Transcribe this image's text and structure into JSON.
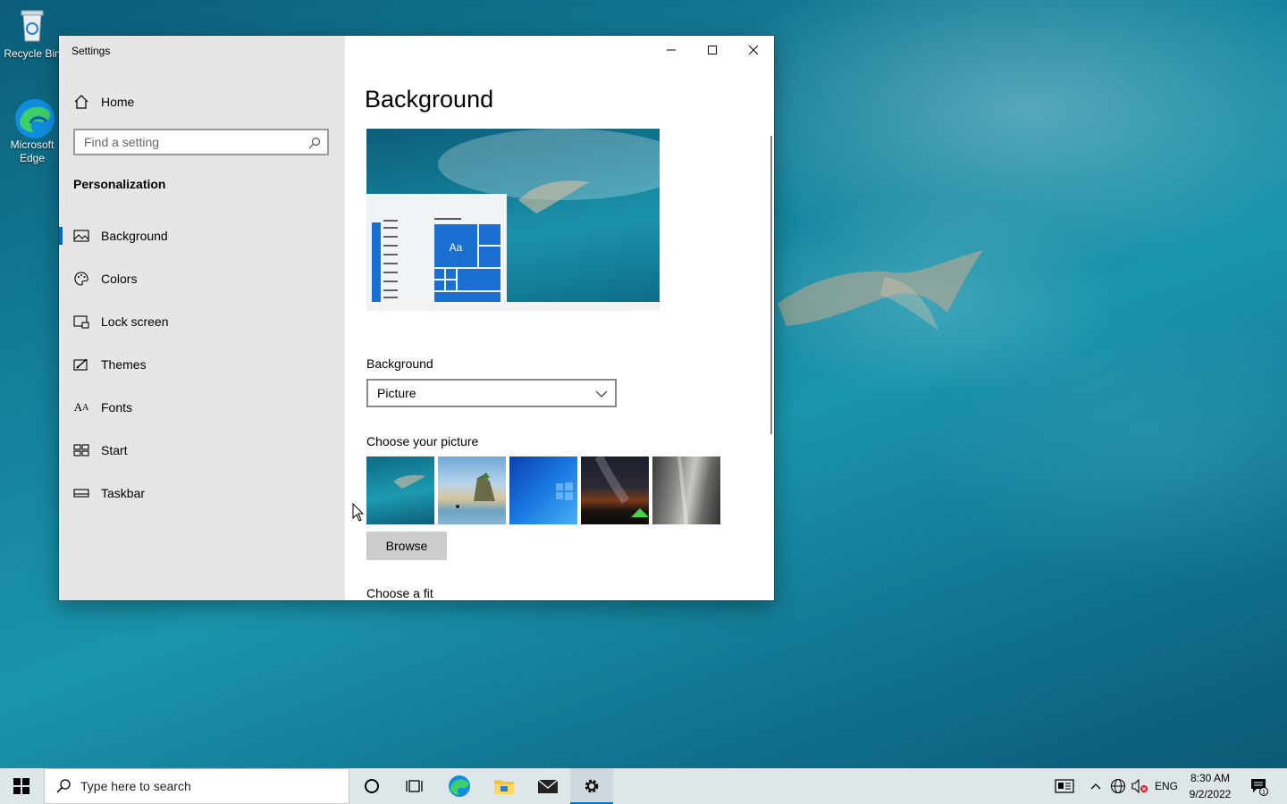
{
  "desktop": {
    "icons": [
      {
        "label": "Recycle Bin",
        "icon": "recycle-bin-icon"
      },
      {
        "label": "Microsoft Edge",
        "icon": "edge-icon"
      }
    ]
  },
  "window": {
    "title": "Settings",
    "controls": {
      "minimize": "minimize-icon",
      "maximize": "maximize-icon",
      "close": "close-icon"
    }
  },
  "sidebar": {
    "home_label": "Home",
    "search_placeholder": "Find a setting",
    "section_title": "Personalization",
    "items": [
      {
        "label": "Background",
        "icon": "picture-icon",
        "active": true
      },
      {
        "label": "Colors",
        "icon": "palette-icon",
        "active": false
      },
      {
        "label": "Lock screen",
        "icon": "lock-screen-icon",
        "active": false
      },
      {
        "label": "Themes",
        "icon": "themes-icon",
        "active": false
      },
      {
        "label": "Fonts",
        "icon": "fonts-icon",
        "active": false
      },
      {
        "label": "Start",
        "icon": "start-icon",
        "active": false
      },
      {
        "label": "Taskbar",
        "icon": "taskbar-icon",
        "active": false
      }
    ]
  },
  "main": {
    "page_title": "Background",
    "preview_tile_text": "Aa",
    "background_label": "Background",
    "background_value": "Picture",
    "choose_picture_label": "Choose your picture",
    "browse_label": "Browse",
    "choose_fit_label": "Choose a fit"
  },
  "taskbar": {
    "search_placeholder": "Type here to search",
    "language": "ENG",
    "time": "8:30 AM",
    "date": "9/2/2022",
    "notification_count": "1",
    "accent_color": "#0078d4"
  }
}
